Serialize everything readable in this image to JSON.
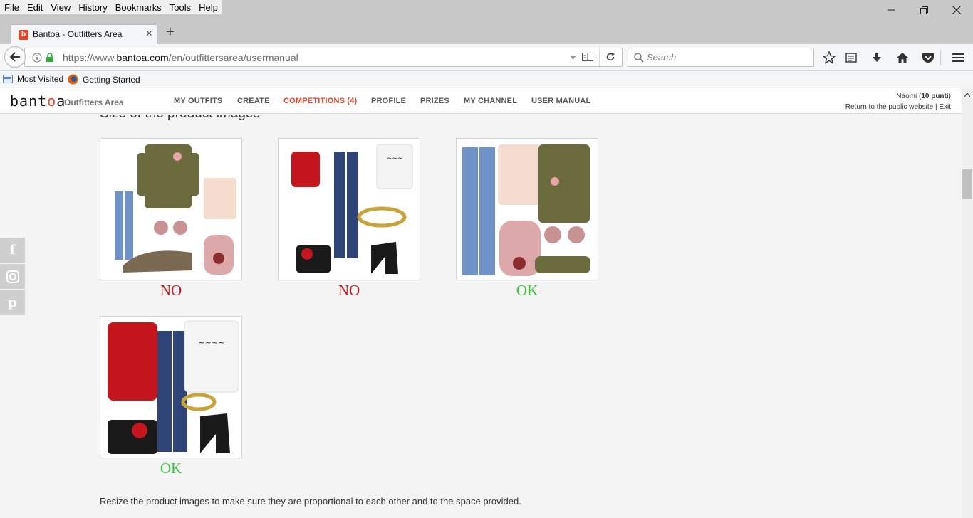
{
  "browser": {
    "menu": [
      "File",
      "Edit",
      "View",
      "History",
      "Bookmarks",
      "Tools",
      "Help"
    ],
    "tab_title": "Bantoa - Outfitters Area",
    "favicon_letter": "b",
    "url_prefix": "https://www.",
    "url_domain": "bantoa.com",
    "url_path": "/en/outfittersarea/usermanual",
    "search_placeholder": "Search",
    "bookmarks": [
      "Most Visited",
      "Getting Started"
    ]
  },
  "site": {
    "logo_text_a": "bant",
    "logo_text_b": "o",
    "logo_text_c": "a",
    "area_label": "Outfitters Area",
    "nav": [
      "MY OUTFITS",
      "CREATE",
      "COMPETITIONS (4)",
      "PROFILE",
      "PRIZES",
      "MY CHANNEL",
      "USER MANUAL"
    ],
    "user_name": "Naomi",
    "user_points": "10 punti",
    "return_link": "Return to the public website",
    "exit_link": "Exit",
    "accent_color": "#e2462b"
  },
  "content": {
    "section_title": "Size of the product images",
    "examples": [
      {
        "verdict": "NO"
      },
      {
        "verdict": "NO"
      },
      {
        "verdict": "OK"
      },
      {
        "verdict": "OK"
      }
    ],
    "description": "Resize the product images to make sure they are proportional to each other and to the space provided."
  },
  "social": [
    "facebook-icon",
    "instagram-icon",
    "pinterest-icon"
  ]
}
